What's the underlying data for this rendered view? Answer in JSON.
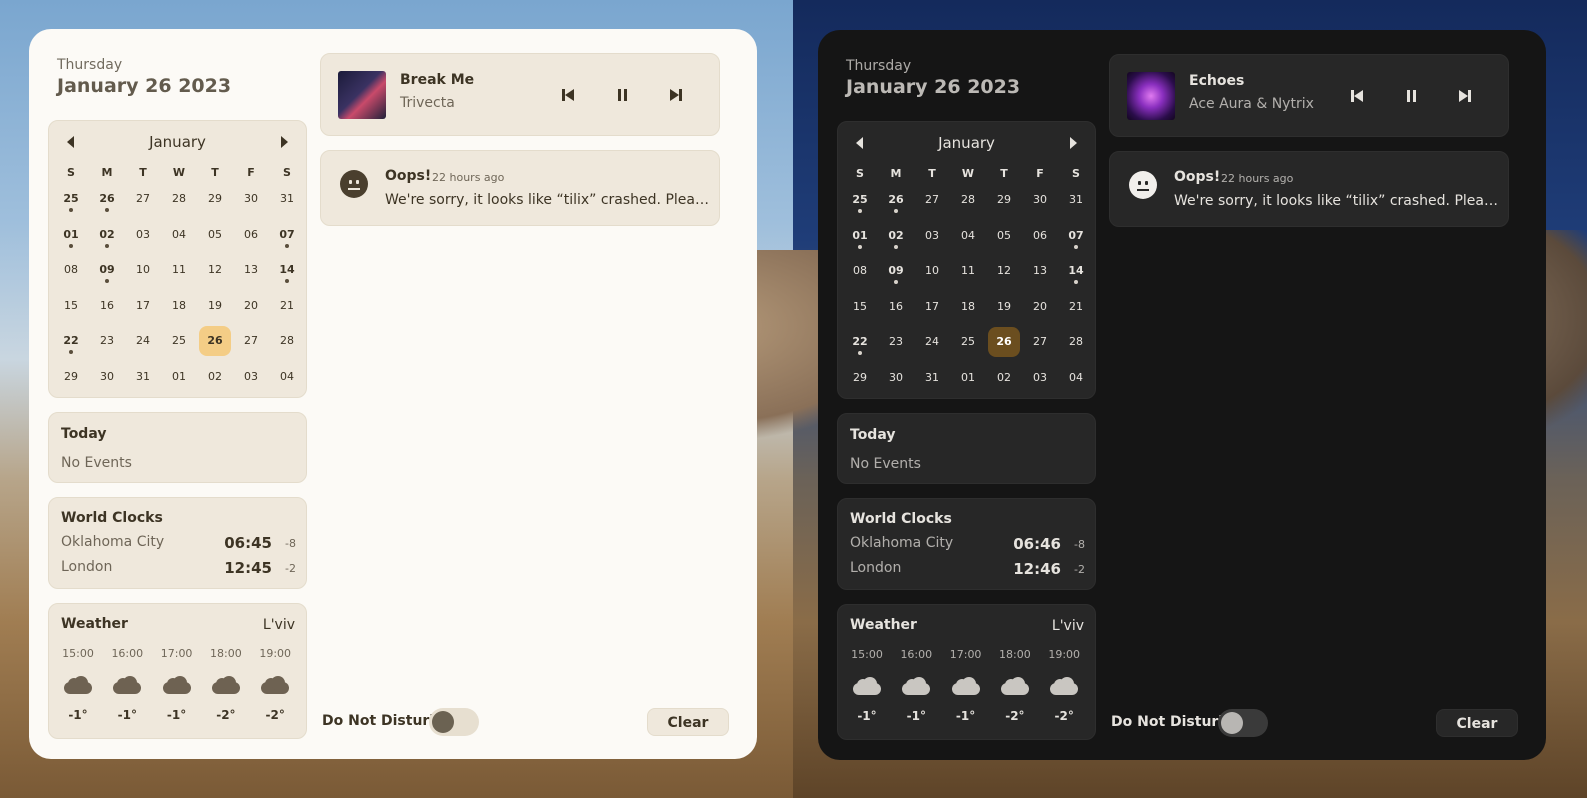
{
  "panels": [
    {
      "theme": "light",
      "day_of_week": "Thursday",
      "full_date": "January 26 2023",
      "calendar": {
        "month": "January",
        "weekdays": [
          "S",
          "M",
          "T",
          "W",
          "T",
          "F",
          "S"
        ],
        "weeks": [
          [
            {
              "d": "25",
              "b": true,
              "dot": true
            },
            {
              "d": "26",
              "b": true,
              "dot": true
            },
            {
              "d": "27"
            },
            {
              "d": "28"
            },
            {
              "d": "29"
            },
            {
              "d": "30"
            },
            {
              "d": "31"
            }
          ],
          [
            {
              "d": "01",
              "b": true,
              "dot": true
            },
            {
              "d": "02",
              "b": true,
              "dot": true
            },
            {
              "d": "03"
            },
            {
              "d": "04"
            },
            {
              "d": "05"
            },
            {
              "d": "06"
            },
            {
              "d": "07",
              "b": true,
              "dot": true
            }
          ],
          [
            {
              "d": "08"
            },
            {
              "d": "09",
              "b": true,
              "dot": true
            },
            {
              "d": "10"
            },
            {
              "d": "11"
            },
            {
              "d": "12"
            },
            {
              "d": "13"
            },
            {
              "d": "14",
              "b": true,
              "dot": true
            }
          ],
          [
            {
              "d": "15"
            },
            {
              "d": "16"
            },
            {
              "d": "17"
            },
            {
              "d": "18"
            },
            {
              "d": "19"
            },
            {
              "d": "20"
            },
            {
              "d": "21"
            }
          ],
          [
            {
              "d": "22",
              "b": true,
              "dot": true
            },
            {
              "d": "23"
            },
            {
              "d": "24"
            },
            {
              "d": "25"
            },
            {
              "d": "26",
              "today": true
            },
            {
              "d": "27"
            },
            {
              "d": "28"
            }
          ],
          [
            {
              "d": "29"
            },
            {
              "d": "30"
            },
            {
              "d": "31"
            },
            {
              "d": "01"
            },
            {
              "d": "02"
            },
            {
              "d": "03"
            },
            {
              "d": "04"
            }
          ]
        ]
      },
      "today": {
        "title": "Today",
        "empty": "No Events"
      },
      "world_clocks": {
        "title": "World Clocks",
        "rows": [
          {
            "city": "Oklahoma City",
            "time": "06:45",
            "offset": "-8"
          },
          {
            "city": "London",
            "time": "12:45",
            "offset": "-2"
          }
        ]
      },
      "weather": {
        "title": "Weather",
        "location": "L'viv",
        "icon": "cloud-icon",
        "hours": [
          {
            "time": "15:00",
            "temp": "-1°"
          },
          {
            "time": "16:00",
            "temp": "-1°"
          },
          {
            "time": "17:00",
            "temp": "-1°"
          },
          {
            "time": "18:00",
            "temp": "-2°"
          },
          {
            "time": "19:00",
            "temp": "-2°"
          }
        ]
      },
      "media": {
        "track": "Break Me",
        "artist": "Trivecta"
      },
      "notification": {
        "title": "Oops!",
        "time": "22 hours ago",
        "body": "We're sorry, it looks like “tilix” crashed. Please contact the developer"
      },
      "dnd_label": "Do Not Disturb",
      "dnd_on": false,
      "clear_label": "Clear"
    },
    {
      "theme": "dark",
      "day_of_week": "Thursday",
      "full_date": "January 26 2023",
      "calendar": {
        "month": "January",
        "weekdays": [
          "S",
          "M",
          "T",
          "W",
          "T",
          "F",
          "S"
        ],
        "weeks": [
          [
            {
              "d": "25",
              "b": true,
              "dot": true
            },
            {
              "d": "26",
              "b": true,
              "dot": true
            },
            {
              "d": "27"
            },
            {
              "d": "28"
            },
            {
              "d": "29"
            },
            {
              "d": "30"
            },
            {
              "d": "31"
            }
          ],
          [
            {
              "d": "01",
              "b": true,
              "dot": true
            },
            {
              "d": "02",
              "b": true,
              "dot": true
            },
            {
              "d": "03"
            },
            {
              "d": "04"
            },
            {
              "d": "05"
            },
            {
              "d": "06"
            },
            {
              "d": "07",
              "b": true,
              "dot": true
            }
          ],
          [
            {
              "d": "08"
            },
            {
              "d": "09",
              "b": true,
              "dot": true
            },
            {
              "d": "10"
            },
            {
              "d": "11"
            },
            {
              "d": "12"
            },
            {
              "d": "13"
            },
            {
              "d": "14",
              "b": true,
              "dot": true
            }
          ],
          [
            {
              "d": "15"
            },
            {
              "d": "16"
            },
            {
              "d": "17"
            },
            {
              "d": "18"
            },
            {
              "d": "19"
            },
            {
              "d": "20"
            },
            {
              "d": "21"
            }
          ],
          [
            {
              "d": "22",
              "b": true,
              "dot": true
            },
            {
              "d": "23"
            },
            {
              "d": "24"
            },
            {
              "d": "25"
            },
            {
              "d": "26",
              "today": true
            },
            {
              "d": "27"
            },
            {
              "d": "28"
            }
          ],
          [
            {
              "d": "29"
            },
            {
              "d": "30"
            },
            {
              "d": "31"
            },
            {
              "d": "01"
            },
            {
              "d": "02"
            },
            {
              "d": "03"
            },
            {
              "d": "04"
            }
          ]
        ]
      },
      "today": {
        "title": "Today",
        "empty": "No Events"
      },
      "world_clocks": {
        "title": "World Clocks",
        "rows": [
          {
            "city": "Oklahoma City",
            "time": "06:46",
            "offset": "-8"
          },
          {
            "city": "London",
            "time": "12:46",
            "offset": "-2"
          }
        ]
      },
      "weather": {
        "title": "Weather",
        "location": "L'viv",
        "icon": "cloud-icon",
        "hours": [
          {
            "time": "15:00",
            "temp": "-1°"
          },
          {
            "time": "16:00",
            "temp": "-1°"
          },
          {
            "time": "17:00",
            "temp": "-1°"
          },
          {
            "time": "18:00",
            "temp": "-2°"
          },
          {
            "time": "19:00",
            "temp": "-2°"
          }
        ]
      },
      "media": {
        "track": "Echoes",
        "artist": "Ace Aura & Nytrix"
      },
      "notification": {
        "title": "Oops!",
        "time": "22 hours ago",
        "body": "We're sorry, it looks like “tilix” crashed. Please contact the developer"
      },
      "dnd_label": "Do Not Disturb",
      "dnd_on": false,
      "clear_label": "Clear"
    }
  ]
}
